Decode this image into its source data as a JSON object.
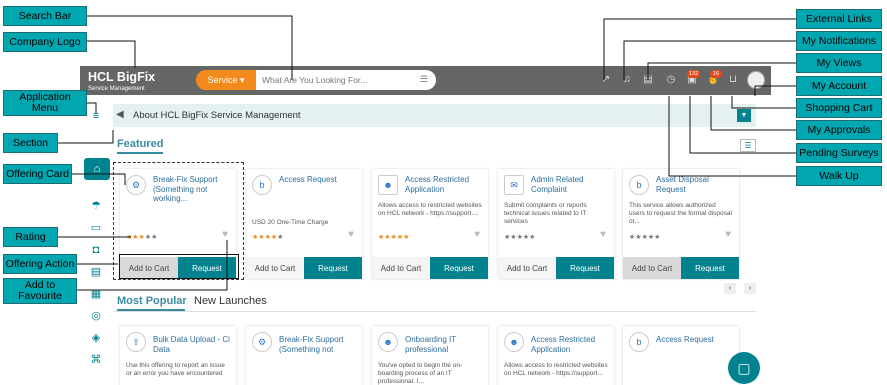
{
  "app": {
    "logo_main": "HCL BigFix",
    "logo_sub": "Service Management",
    "service_button": "Service ▾",
    "search_placeholder": "What Are You Looking For...",
    "notifications_badge": "132",
    "approvals_badge": "16",
    "announcement": "About HCL BigFix Service Management",
    "featured_heading": "Featured",
    "tab_most_popular": "Most Popular",
    "tab_new_launches": "New Launches",
    "accent_color": "#00838f",
    "orange_color": "#f28a1c",
    "featured_cards": [
      {
        "title": "Break-Fix Support (Something not working...",
        "desc": "",
        "price": "",
        "stars": "★★★★★",
        "icon": "gear-icon",
        "add": "Add to Cart",
        "request": "Request"
      },
      {
        "title": "Access Request",
        "desc": "",
        "price": "USD 20 One-Time Charge",
        "stars": "★★★★★",
        "icon": "b-logo-icon",
        "add": "Add to Cart",
        "request": "Request"
      },
      {
        "title": "Access Restricted Application",
        "desc": "Allows access to restricted websites on HCL network - https://support....",
        "price": "",
        "stars": "★★★★★",
        "icon": "person-icon",
        "add": "Add to Cart",
        "request": "Request"
      },
      {
        "title": "Admin Related Complaint",
        "desc": "Submit complaints or reports technical issues related to IT services",
        "price": "",
        "stars": "★★★★★",
        "icon": "complaint-icon",
        "add": "Add to Cart",
        "request": "Request"
      },
      {
        "title": "Asset Disposal Request",
        "desc": "This service allows authorized users to request the formal disposal or...",
        "price": "",
        "stars": "★★★★★",
        "icon": "b-logo-icon",
        "add": "Add to Cart",
        "request": "Request"
      }
    ],
    "popular_cards": [
      {
        "title": "Bulk Data Upload - Ci Data",
        "desc": "Use this offering to report an issue or an error you have encountered",
        "icon": "upload-icon"
      },
      {
        "title": "Break-Fix Support (Something not working...",
        "desc": "",
        "icon": "gear-icon"
      },
      {
        "title": "Onboarding IT professional",
        "desc": "You've opted to begin the on-boarding process of an IT professional. I...",
        "icon": "person-icon"
      },
      {
        "title": "Access Restricted Application",
        "desc": "Allows access to restricted websites on HCL network - https://support...",
        "icon": "person-icon"
      },
      {
        "title": "Access Request",
        "desc": "",
        "icon": "b-logo-icon"
      }
    ]
  },
  "callouts": {
    "search_bar": "Search Bar",
    "company_logo": "Company Logo",
    "application_menu_1": "Application",
    "application_menu_2": "Menu",
    "section": "Section",
    "offering_card": "Offering Card",
    "rating": "Rating",
    "offering_action": "Offering Action",
    "add_to_favourite_1": "Add to",
    "add_to_favourite_2": "Favourite",
    "external_links": "External Links",
    "my_notifications": "My Notifications",
    "my_views": "My Views",
    "my_account": "My Account",
    "shopping_cart": "Shopping Cart",
    "my_approvals": "My Approvals",
    "pending_surveys": "Pending Surveys",
    "walk_up": "Walk Up"
  }
}
